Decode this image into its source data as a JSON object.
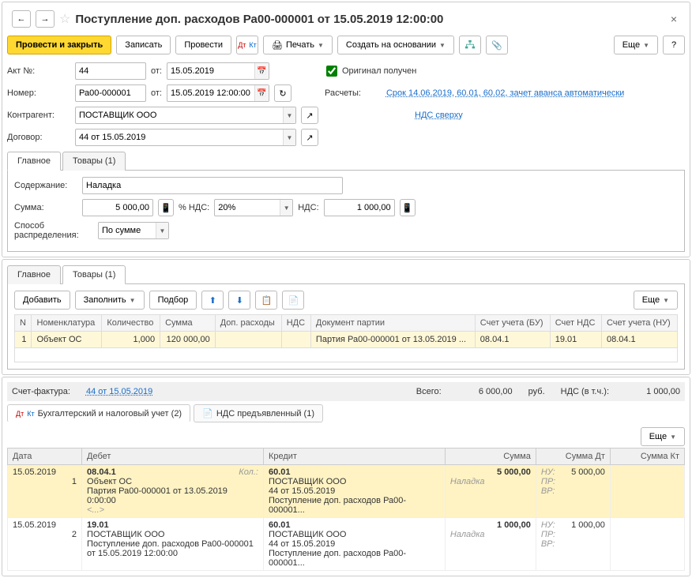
{
  "title": "Поступление доп. расходов Ра00-000001 от 15.05.2019 12:00:00",
  "toolbar": {
    "post_close": "Провести и закрыть",
    "save": "Записать",
    "post": "Провести",
    "print": "Печать",
    "create_based": "Создать на основании",
    "more": "Еще"
  },
  "head": {
    "act_no_lbl": "Акт №:",
    "act_no": "44",
    "from_lbl": "от:",
    "act_date": "15.05.2019",
    "original_lbl": "Оригинал получен",
    "number_lbl": "Номер:",
    "number": "Ра00-000001",
    "number_date": "15.05.2019 12:00:00",
    "calc_lbl": "Расчеты:",
    "calc_link": "Срок 14.06.2019, 60.01, 60.02, зачет аванса автоматически",
    "contr_lbl": "Контрагент:",
    "contr": "ПОСТАВЩИК ООО",
    "nds_link": "НДС сверху",
    "contract_lbl": "Договор:",
    "contract": "44 от 15.05.2019"
  },
  "tabs1": {
    "main": "Главное",
    "goods": "Товары (1)"
  },
  "main_tab": {
    "content_lbl": "Содержание:",
    "content": "Наладка",
    "sum_lbl": "Сумма:",
    "sum": "5 000,00",
    "nds_pct_lbl": "% НДС:",
    "nds_pct": "20%",
    "nds_lbl": "НДС:",
    "nds": "1 000,00",
    "dist_lbl": "Способ распределения:",
    "dist": "По сумме"
  },
  "goods_toolbar": {
    "add": "Добавить",
    "fill": "Заполнить",
    "pick": "Подбор",
    "more": "Еще"
  },
  "goods_cols": {
    "n": "N",
    "nomen": "Номенклатура",
    "qty": "Количество",
    "sum": "Сумма",
    "addcost": "Доп. расходы",
    "nds": "НДС",
    "batch": "Документ партии",
    "acc_bu": "Счет учета (БУ)",
    "acc_nds": "Счет НДС",
    "acc_nu": "Счет учета (НУ)"
  },
  "goods_rows": [
    {
      "n": "1",
      "nomen": "Объект ОС",
      "qty": "1,000",
      "sum": "120 000,00",
      "addcost": "",
      "nds": "",
      "batch": "Партия Ра00-000001 от 13.05.2019 ...",
      "acc_bu": "08.04.1",
      "acc_nds": "19.01",
      "acc_nu": "08.04.1"
    }
  ],
  "invoice": {
    "lbl": "Счет-фактура:",
    "link": "44 от 15.05.2019"
  },
  "totals": {
    "total_lbl": "Всего:",
    "total": "6 000,00",
    "cur": "руб.",
    "nds_lbl": "НДС (в т.ч.):",
    "nds": "1 000,00"
  },
  "jtabs": {
    "acc": "Бухгалтерский и налоговый учет (2)",
    "nds": "НДС предъявленный (1)"
  },
  "jcols": {
    "date": "Дата",
    "debit": "Дебет",
    "credit": "Кредит",
    "sum": "Сумма",
    "sum_dt": "Сумма Дт",
    "sum_kt": "Сумма Кт"
  },
  "jrows": [
    {
      "date": "15.05.2019",
      "n": "1",
      "hl": true,
      "d_acc": "08.04.1",
      "d_qty_lbl": "Кол.:",
      "d_l1": "Объект ОС",
      "d_l2": "Партия Ра00-000001 от 13.05.2019 0:00:00",
      "d_l3": "<...>",
      "c_acc": "60.01",
      "c_l1": "ПОСТАВЩИК ООО",
      "c_l2": "44 от 15.05.2019",
      "c_l3": "Поступление доп. расходов Ра00-000001...",
      "sum": "5 000,00",
      "sum_note": "Наладка",
      "dt_nu": "НУ:",
      "dt_val": "5 000,00",
      "pr": "ПР:",
      "vr": "ВР:"
    },
    {
      "date": "15.05.2019",
      "n": "2",
      "hl": false,
      "d_acc": "19.01",
      "d_l1": "ПОСТАВЩИК ООО",
      "d_l2": "Поступление доп. расходов Ра00-000001 от 15.05.2019 12:00:00",
      "d_l3": "",
      "c_acc": "60.01",
      "c_l1": "ПОСТАВЩИК ООО",
      "c_l2": "44 от 15.05.2019",
      "c_l3": "Поступление доп. расходов Ра00-000001...",
      "sum": "1 000,00",
      "sum_note": "Наладка",
      "dt_nu": "НУ:",
      "dt_val": "1 000,00",
      "pr": "ПР:",
      "vr": "ВР:"
    }
  ]
}
